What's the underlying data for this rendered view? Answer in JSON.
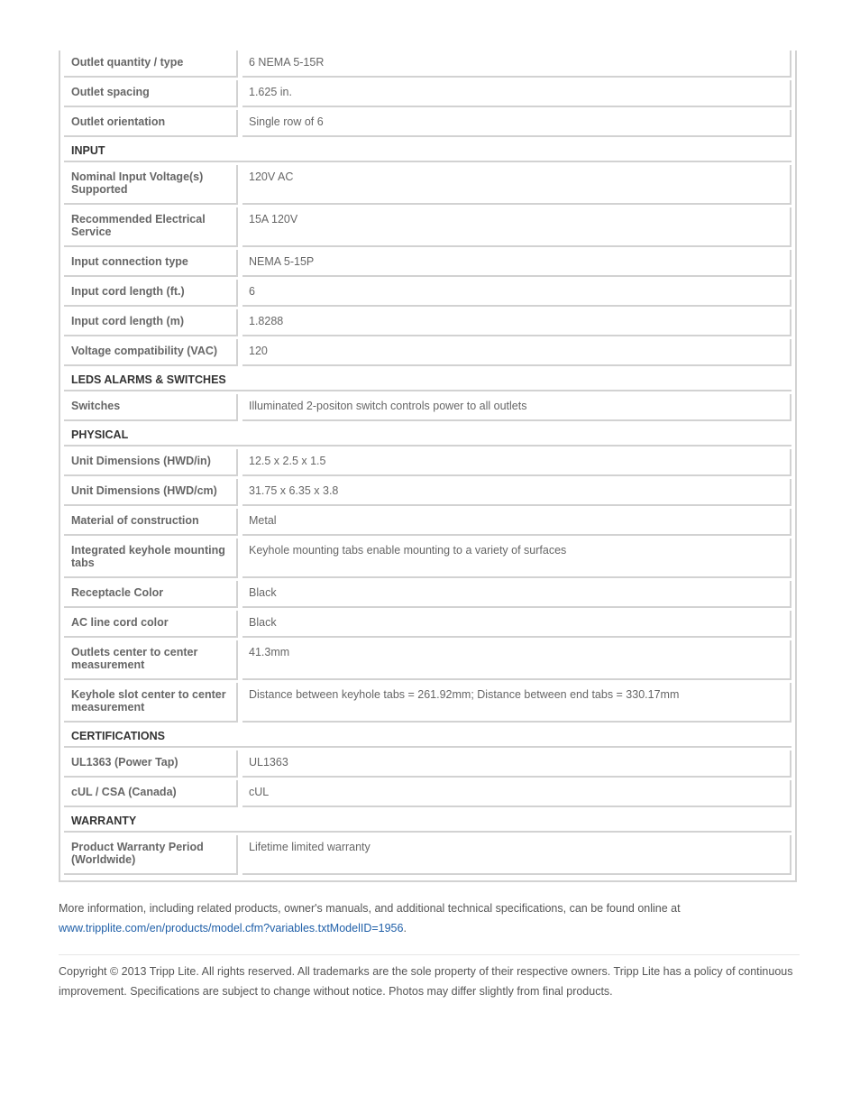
{
  "spec_table": {
    "rows_top": [
      {
        "label": "Outlet quantity / type",
        "value": "6 NEMA 5-15R"
      },
      {
        "label": "Outlet spacing",
        "value": "1.625 in."
      },
      {
        "label": "Outlet orientation",
        "value": "Single row of 6"
      }
    ],
    "sections": [
      {
        "title": "INPUT",
        "rows": [
          {
            "label": "Nominal Input Voltage(s) Supported",
            "value": "120V AC"
          },
          {
            "label": "Recommended Electrical Service",
            "value": "15A 120V"
          },
          {
            "label": "Input connection type",
            "value": "NEMA 5-15P"
          },
          {
            "label": "Input cord length (ft.)",
            "value": "6"
          },
          {
            "label": "Input cord length (m)",
            "value": "1.8288"
          },
          {
            "label": "Voltage compatibility (VAC)",
            "value": "120"
          }
        ]
      },
      {
        "title": "LEDS ALARMS & SWITCHES",
        "rows": [
          {
            "label": "Switches",
            "value": "Illuminated 2-positon switch controls power to all outlets"
          }
        ]
      },
      {
        "title": "PHYSICAL",
        "rows": [
          {
            "label": "Unit Dimensions (HWD/in)",
            "value": "12.5 x 2.5 x 1.5"
          },
          {
            "label": "Unit Dimensions (HWD/cm)",
            "value": "31.75 x 6.35 x 3.8"
          },
          {
            "label": "Material of construction",
            "value": "Metal"
          },
          {
            "label": "Integrated keyhole mounting tabs",
            "value": "Keyhole mounting tabs enable mounting to a variety of surfaces"
          },
          {
            "label": "Receptacle Color",
            "value": "Black"
          },
          {
            "label": "AC line cord color",
            "value": "Black"
          },
          {
            "label": "Outlets center to center measurement",
            "value": "41.3mm"
          },
          {
            "label": "Keyhole slot center to center measurement",
            "value": "Distance between keyhole tabs = 261.92mm; Distance between end tabs = 330.17mm"
          }
        ]
      },
      {
        "title": "CERTIFICATIONS",
        "rows": [
          {
            "label": "UL1363 (Power Tap)",
            "value": "UL1363"
          },
          {
            "label": "cUL / CSA (Canada)",
            "value": "cUL"
          }
        ]
      },
      {
        "title": "WARRANTY",
        "rows": [
          {
            "label": "Product Warranty Period (Worldwide)",
            "value": "Lifetime limited warranty"
          }
        ]
      }
    ]
  },
  "footer": {
    "more_info_text": "More information, including related products, owner's manuals, and additional technical specifications, can be found online at",
    "link_text": "www.tripplite.com/en/products/model.cfm?variables.txtModelID=1956",
    "link_suffix": ".",
    "copyright": "Copyright © 2013 Tripp Lite. All rights reserved. All trademarks are the sole property of their respective owners. Tripp Lite has a policy of continuous improvement. Specifications are subject to change without notice. Photos may differ slightly from final products."
  },
  "colors": {
    "link": "#1f5fa8",
    "label_text": "#666666",
    "section_text": "#333333",
    "border": "#d2d2d2"
  }
}
